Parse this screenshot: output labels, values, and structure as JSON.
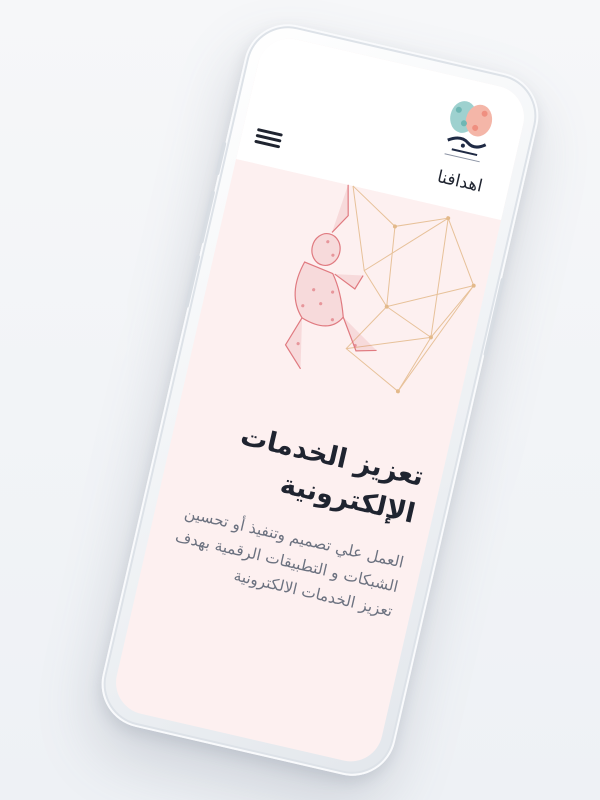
{
  "header": {
    "nav_title": "اهدافنا",
    "logo_icon": "brain-logo-icon",
    "menu_icon": "hamburger-menu-icon"
  },
  "hero": {
    "illustration": "climber-network-illustration"
  },
  "content": {
    "heading": "تعزيز الخدمات الإلكترونية",
    "description": "العمل علي تصميم وتنفيذ أو تحسين الشبكات و التطبيقات الرقمية بهدف تعزيز الخدمات الالكترونية"
  },
  "colors": {
    "screen_bg": "#fdf0f0",
    "heading": "#1f2430",
    "body_text": "#6c7280",
    "accent_red": "#e07a80",
    "accent_gold": "#e3b98a"
  }
}
